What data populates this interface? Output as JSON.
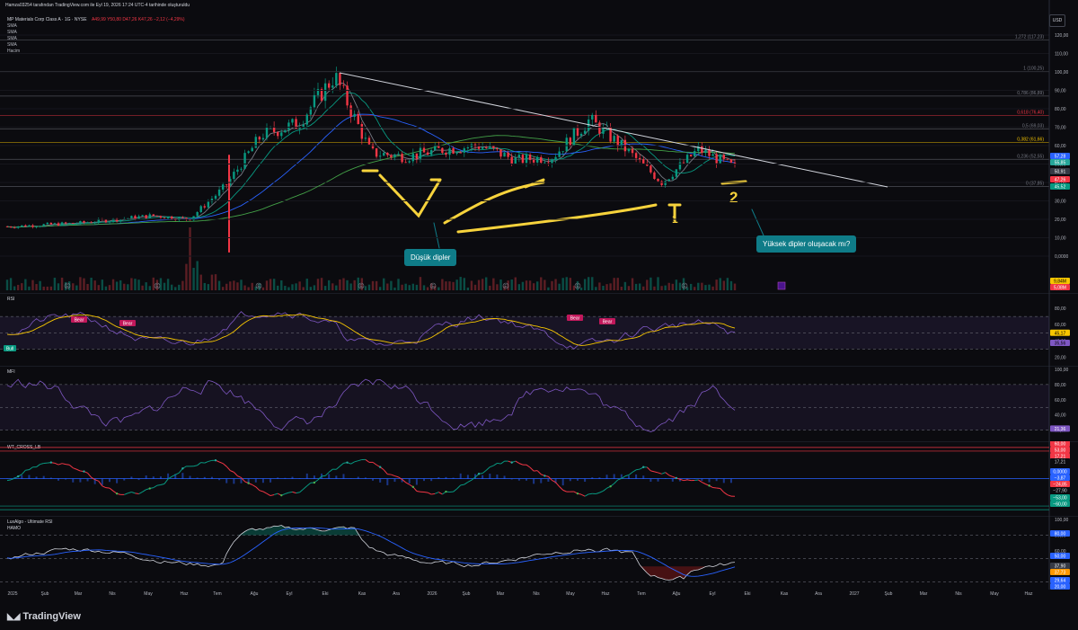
{
  "header": {
    "credit": "Hamza03254 tarafından TradingView.com ile Eyl 19, 2026 17:24 UTC-4 tarihinde oluşturuldu",
    "symbol": "MP Materials Corp Class A · 1G · NYSE",
    "ohlc": "A49,99  Y50,80  D47,26  K47,26  −2,12 (−4,29%)",
    "indicators": [
      "SMA",
      "SMA",
      "SMA",
      "SMA",
      "Hacim"
    ],
    "currency": "USD"
  },
  "price_axis": {
    "ticks": [
      "120,00",
      "110,00",
      "100,00",
      "90,00",
      "80,00",
      "70,00",
      "60,00",
      "50,00",
      "40,00",
      "30,00",
      "20,00",
      "10,00",
      "0,0000"
    ],
    "labels": [
      {
        "text": "57,28",
        "color": "#2962ff"
      },
      {
        "text": "55,85",
        "color": "#26a69a"
      },
      {
        "text": "50,91",
        "color": "#363a45"
      },
      {
        "text": "47,26",
        "color": "#f23645"
      },
      {
        "text": "45,52",
        "color": "#089981"
      }
    ],
    "volume_labels": [
      {
        "text": "9,84M",
        "color": "#f7c600"
      },
      {
        "text": "5,08M",
        "color": "#f23645"
      }
    ]
  },
  "fibs": [
    {
      "text": "1,272 (117,23)",
      "color": "#787b86"
    },
    {
      "text": "1 (100,25)",
      "color": "#787b86"
    },
    {
      "text": "0,786 (86,89)",
      "color": "#787b86"
    },
    {
      "text": "0,618 (76,40)",
      "color": "#f23645"
    },
    {
      "text": "0,5 (69,03)",
      "color": "#787b86"
    },
    {
      "text": "0,382 (61,66)",
      "color": "#f7c600"
    },
    {
      "text": "0,236 (52,55)",
      "color": "#787b86"
    },
    {
      "text": "0 (37,85)",
      "color": "#787b86"
    }
  ],
  "annotations": {
    "low_dips": "Düşük dipler",
    "higher_lows_q": "Yüksek dipler oluşacak mı?",
    "mark1": "1",
    "mark2": "2"
  },
  "rsi": {
    "title": "RSI",
    "ticks": [
      "80,00",
      "60,00",
      "40,00",
      "20,00"
    ],
    "labels": [
      {
        "text": "45,17",
        "color": "#f7c600"
      },
      {
        "text": "35,56",
        "color": "#7e57c2"
      }
    ],
    "bear": "Bear",
    "bull": "Bull"
  },
  "mfi": {
    "title": "MFI",
    "ticks": [
      "100,00",
      "80,00",
      "60,00",
      "40,00",
      "20,00"
    ],
    "labels": [
      {
        "text": "21,36",
        "color": "#7e57c2"
      }
    ]
  },
  "wt": {
    "title": "WT_CROSS_LB",
    "ticks": [
      "60,00",
      "53,00",
      "40,00",
      "0,0000",
      "−40,00",
      "−60,00"
    ],
    "labels": [
      {
        "text": "60,00",
        "color": "#f23645"
      },
      {
        "text": "53,00",
        "color": "#f23645"
      },
      {
        "text": "17,21",
        "color": "#f23645"
      },
      {
        "text": "17,21",
        "color": "#0b0b0f"
      },
      {
        "text": "0,0000",
        "color": "#2962ff"
      },
      {
        "text": "−3,87",
        "color": "#2962ff"
      },
      {
        "text": "−24,85",
        "color": "#f23645"
      },
      {
        "text": "−27,90",
        "color": "#0b0b0f"
      },
      {
        "text": "−53,00",
        "color": "#089981"
      },
      {
        "text": "−60,00",
        "color": "#089981"
      }
    ]
  },
  "ursi": {
    "title": "LuxAlgo - Ultimate RSI",
    "subtitle": "HAMO",
    "ticks": [
      "100,00",
      "80,00",
      "60,00",
      "40,00",
      "20,00"
    ],
    "labels": [
      {
        "text": "80,00",
        "color": "#2962ff"
      },
      {
        "text": "50,00",
        "color": "#2962ff"
      },
      {
        "text": "37,90",
        "color": "#363a45"
      },
      {
        "text": "37,73",
        "color": "#ff9800"
      },
      {
        "text": "29,64",
        "color": "#2962ff"
      },
      {
        "text": "20,00",
        "color": "#2962ff"
      }
    ]
  },
  "time_axis": [
    "2025",
    "Şub",
    "Mar",
    "Nis",
    "May",
    "Haz",
    "Tem",
    "Ağu",
    "Eyl",
    "Eki",
    "Kas",
    "Ara",
    "2026",
    "Şub",
    "Mar",
    "Nis",
    "May",
    "Haz",
    "Tem",
    "Ağu",
    "Eyl",
    "Eki",
    "Kas",
    "Ara",
    "2027",
    "Şub",
    "Mar",
    "Nis",
    "May",
    "Haz"
  ],
  "brand": "TradingView",
  "chart_data": {
    "type": "line",
    "xlabel": "",
    "ylabel": "",
    "price_path": [
      [
        "2025-01",
        16
      ],
      [
        "2025-02",
        17
      ],
      [
        "2025-03",
        18
      ],
      [
        "2025-04",
        20
      ],
      [
        "2025-05",
        22
      ],
      [
        "2025-06",
        20
      ],
      [
        "2025-07",
        38
      ],
      [
        "2025-08",
        66
      ],
      [
        "2025-09",
        72
      ],
      [
        "2025-10",
        98
      ],
      [
        "2025-11",
        56
      ],
      [
        "2025-12",
        54
      ],
      [
        "2026-01",
        58
      ],
      [
        "2026-02",
        60
      ],
      [
        "2026-03",
        52
      ],
      [
        "2026-04",
        54
      ],
      [
        "2026-05",
        74
      ],
      [
        "2026-06",
        58
      ],
      [
        "2026-07",
        40
      ],
      [
        "2026-08",
        58
      ],
      [
        "2026-09",
        48
      ]
    ],
    "ylim": [
      0,
      125
    ]
  }
}
